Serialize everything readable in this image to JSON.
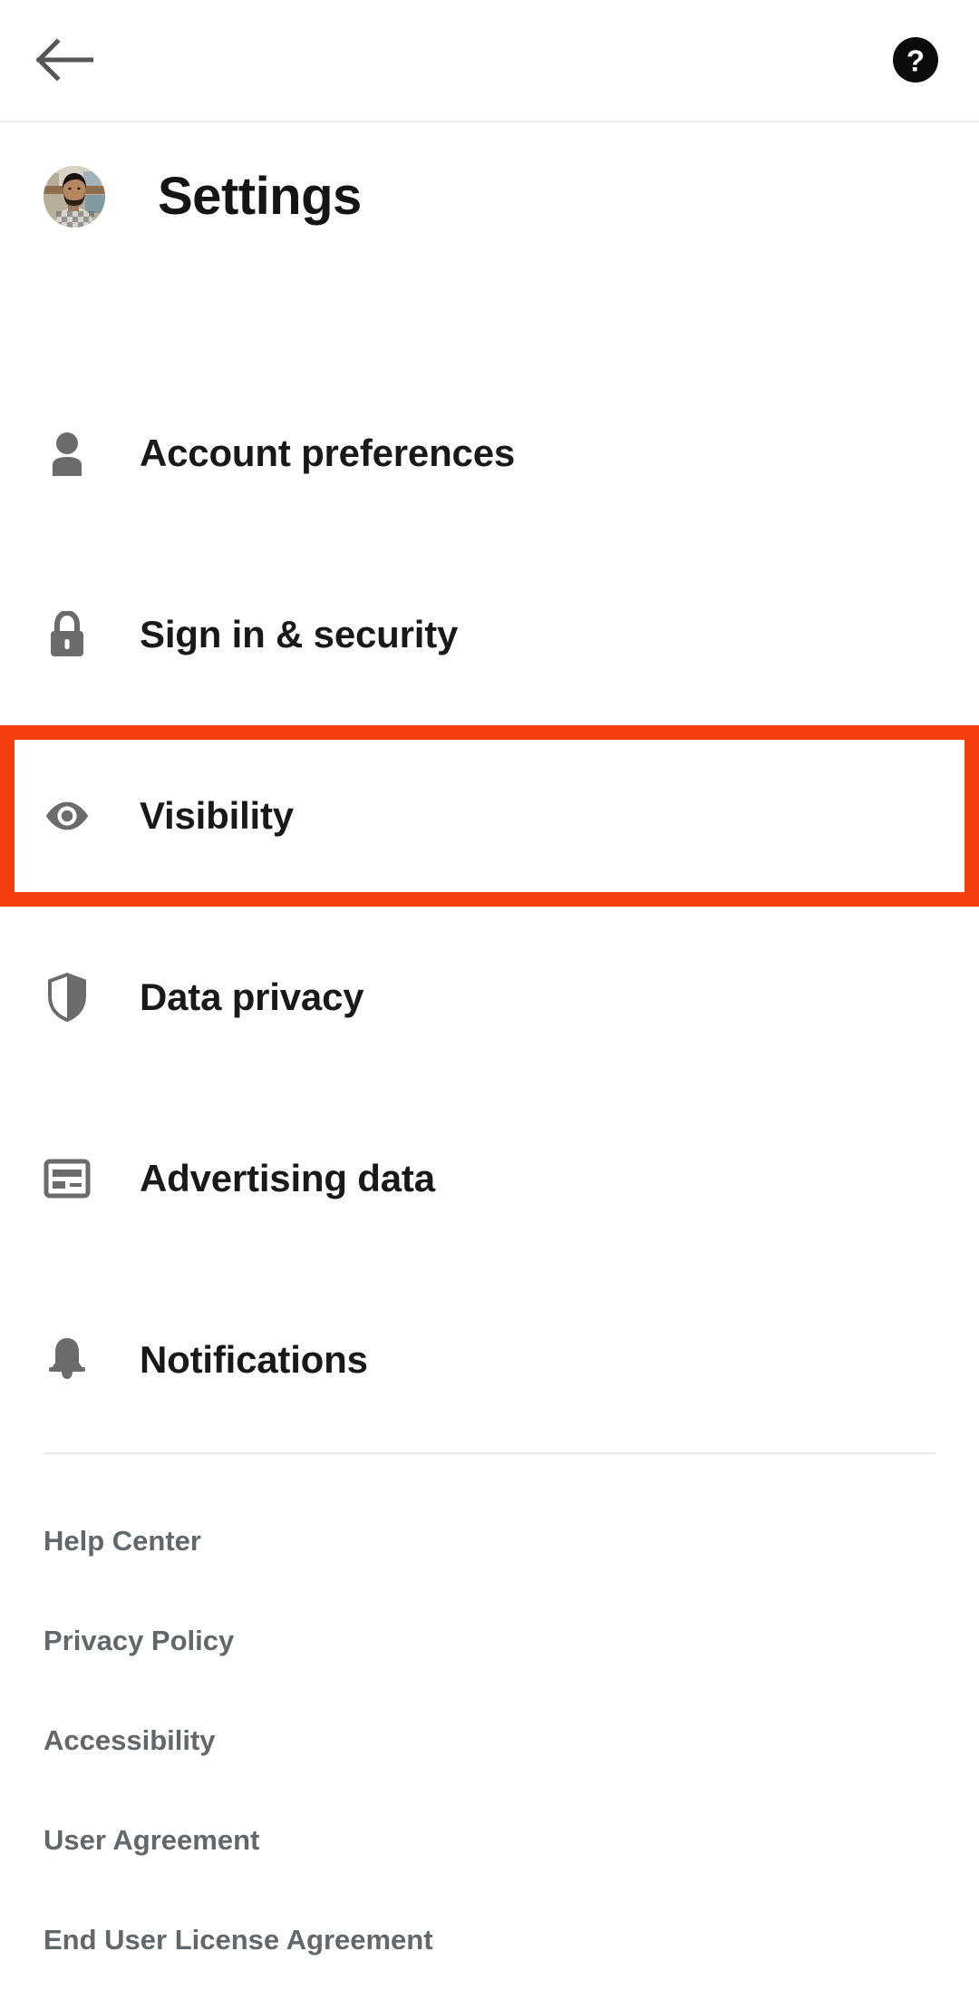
{
  "topbar": {
    "back_icon": "arrow-left-icon",
    "help_icon": "help-circle-icon",
    "help_glyph": "?"
  },
  "header": {
    "title": "Settings",
    "avatar_alt": "profile-photo"
  },
  "menu": {
    "items": [
      {
        "label": "Account preferences",
        "icon": "person-icon",
        "highlighted": false
      },
      {
        "label": "Sign in & security",
        "icon": "lock-icon",
        "highlighted": false
      },
      {
        "label": "Visibility",
        "icon": "eye-icon",
        "highlighted": true
      },
      {
        "label": "Data privacy",
        "icon": "shield-icon",
        "highlighted": false
      },
      {
        "label": "Advertising data",
        "icon": "ad-card-icon",
        "highlighted": false
      },
      {
        "label": "Notifications",
        "icon": "bell-icon",
        "highlighted": false
      }
    ]
  },
  "footer": {
    "links": [
      {
        "label": "Help Center"
      },
      {
        "label": "Privacy Policy"
      },
      {
        "label": "Accessibility"
      },
      {
        "label": "User Agreement"
      },
      {
        "label": "End User License Agreement"
      }
    ]
  },
  "colors": {
    "highlight": "#F4400F",
    "icon_gray": "#6B6B6B",
    "text_primary": "#191919",
    "text_secondary": "#61676B",
    "background": "#FFFFFF"
  }
}
